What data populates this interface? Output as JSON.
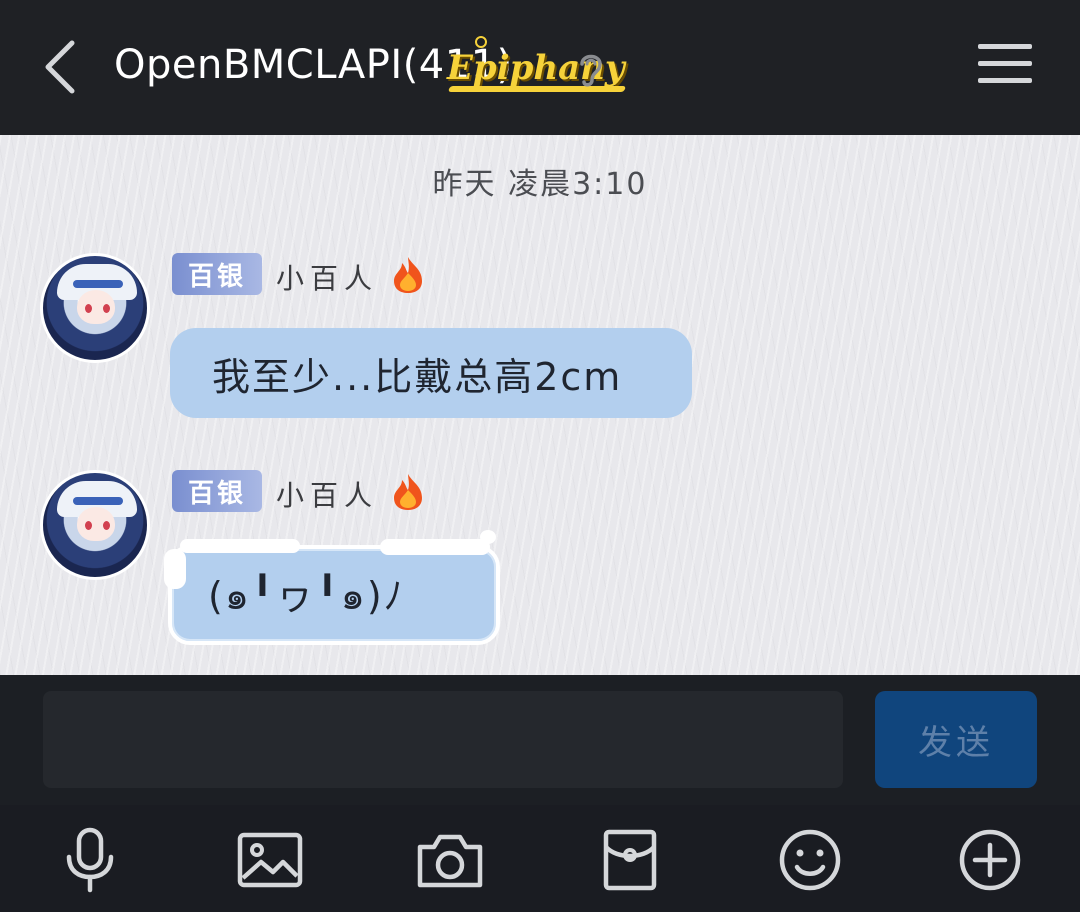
{
  "header": {
    "title": "OpenBMCLAPI(411)",
    "badge": "Epiphany",
    "icons": {
      "back": "chevron-left-icon",
      "ear": "ear-icon",
      "menu": "hamburger-menu-icon"
    }
  },
  "chat": {
    "timestamp": "昨天 凌晨3:10",
    "messages": [
      {
        "tag": "百银",
        "sender": "小百人",
        "text": "我至少...比戴总高2cm"
      },
      {
        "tag": "百银",
        "sender": "小百人",
        "text": "(๑╹ヮ╹๑)ﾉ"
      }
    ]
  },
  "input": {
    "placeholder": "",
    "value": "",
    "send_label": "发送"
  },
  "toolbar": {
    "items": [
      "microphone-icon",
      "image-icon",
      "camera-icon",
      "red-packet-icon",
      "emoji-icon",
      "plus-icon"
    ]
  },
  "colors": {
    "header_bg": "#1f2125",
    "bubble": "#b3cfee",
    "send_button": "#10457d",
    "tag_gradient_start": "#7a8fd0",
    "tag_gradient_end": "#a9b8e4"
  }
}
